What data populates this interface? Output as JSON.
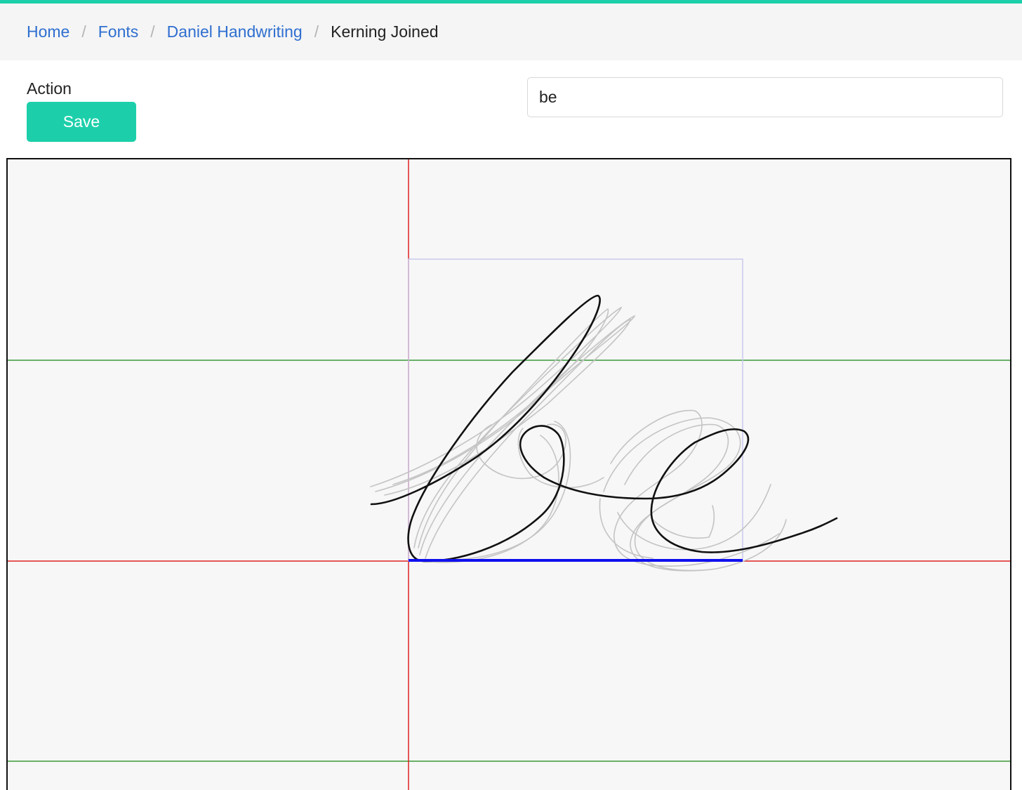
{
  "breadcrumb": {
    "items": [
      {
        "label": "Home",
        "link": true
      },
      {
        "label": "Fonts",
        "link": true
      },
      {
        "label": "Daniel Handwriting",
        "link": true
      },
      {
        "label": "Kerning Joined",
        "link": false
      }
    ],
    "separator": "/"
  },
  "form": {
    "action_label": "Action",
    "save_label": "Save",
    "text_value": "be"
  },
  "colors": {
    "accent": "#1ccfaa",
    "link": "#2f6fd0",
    "guide_vertical": "#e02020",
    "guide_baseline": "#e02020",
    "guide_horizontal": "#3a9a3a",
    "glyph_box": "#c9c9ee",
    "advance_bar": "#1010ee",
    "stroke": "#111111",
    "ghost_stroke": "#c4c4c4"
  }
}
